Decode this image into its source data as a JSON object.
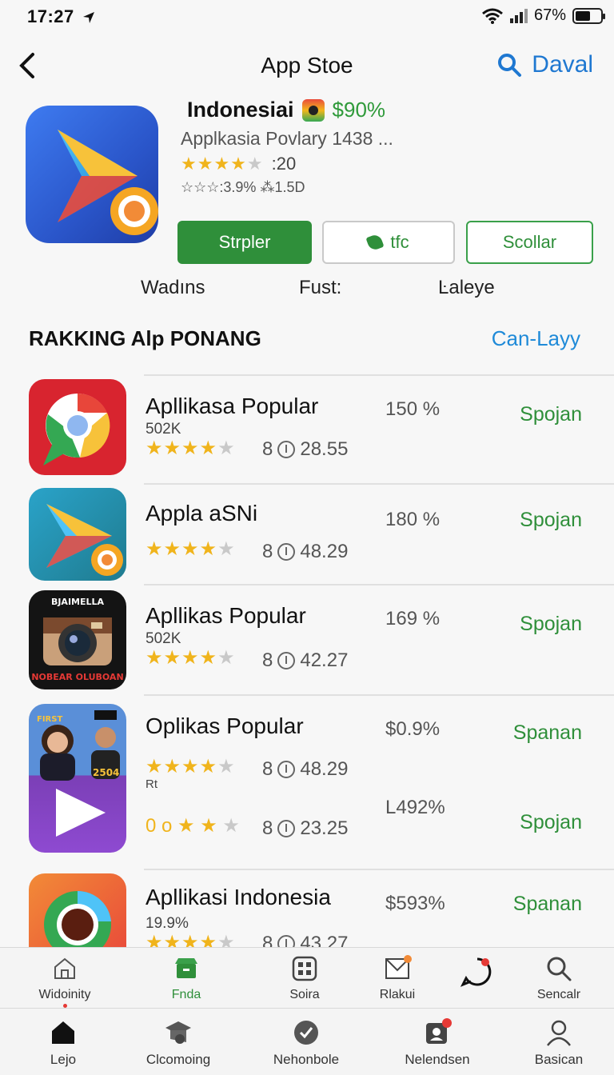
{
  "status": {
    "time": "17:27",
    "battery": "67%",
    "icons": [
      "location-arrow-icon",
      "wifi-icon",
      "signal-icon",
      "battery-icon"
    ]
  },
  "nav": {
    "title": "App Stoe",
    "search_label": "Daval"
  },
  "hero": {
    "name": "Indonesiai",
    "percent": "$90%",
    "subtitle": "Applkasia Povlary 1438 ...",
    "rating": ":20",
    "meta": "☆☆☆:3.9%  ⁂1.5D",
    "buttons": {
      "primary": "Strpler",
      "middle": "tfc",
      "outline": "Scollar"
    },
    "labels": [
      "Wadıns",
      "Fust:",
      "Ŀaleye"
    ]
  },
  "section": {
    "title": "RAKKING Alp PONANG",
    "link": "Can-Layy"
  },
  "apps": [
    {
      "name": "Apllikasa Popular",
      "sub": "502K",
      "score": "28.55",
      "score_prefix": "8",
      "pct": "150 %",
      "action": "Spojan",
      "stars": 4
    },
    {
      "name": "Appla aSNi",
      "sub": "",
      "score": "48.29",
      "score_prefix": "8",
      "pct": "180 %",
      "action": "Spojan",
      "stars": 4
    },
    {
      "name": "Apllikas Popular",
      "sub": "502K",
      "score": "42.27",
      "score_prefix": "8",
      "pct": "169 %",
      "action": "Spojan",
      "stars": 4.5,
      "icon_text_top": "BJAIMELLA",
      "icon_text_bottom": "NOBEAR OLUBOAN"
    },
    {
      "name": "Oplikas Popular",
      "sub": "",
      "score": "48.29",
      "score_prefix": "8",
      "pct": "$0.9%",
      "action": "Spanan",
      "stars": 4.5,
      "icon_text_tag": "2504",
      "icon_text_first": "FIRST"
    },
    {
      "name": "",
      "sub": "Rt",
      "score": "23.25",
      "score_prefix": "8",
      "pct": "L492%",
      "action": "Spojan",
      "stars_text": "0 o"
    },
    {
      "name": "Apllikasi Indonesia",
      "sub": "19.9%",
      "score": "43.27",
      "score_prefix": "8",
      "pct": "$593%",
      "action": "Spanan",
      "stars": 4
    }
  ],
  "tabbar_top": [
    {
      "label": "Widoinity",
      "icon": "home-outline-icon"
    },
    {
      "label": "Fnda",
      "icon": "store-icon",
      "active": true
    },
    {
      "label": "Soira",
      "icon": "grid-icon"
    },
    {
      "label": "Rlakui",
      "icon": "mail-icon"
    },
    {
      "label": "",
      "icon": "chat-bubble-icon"
    },
    {
      "label": "Sencalr",
      "icon": "search-icon"
    }
  ],
  "tabbar_bottom": [
    {
      "label": "Lejo",
      "icon": "home-filled-icon"
    },
    {
      "label": "Clcomoing",
      "icon": "graduation-cap-icon"
    },
    {
      "label": "Nehonbole",
      "icon": "verified-badge-icon"
    },
    {
      "label": "Nelendsen",
      "icon": "notification-card-icon"
    },
    {
      "label": "Basican",
      "icon": "person-icon"
    }
  ],
  "colors": {
    "accent_green": "#2f8f3a",
    "link_blue": "#1f8ad8",
    "star": "#f0b41c"
  }
}
